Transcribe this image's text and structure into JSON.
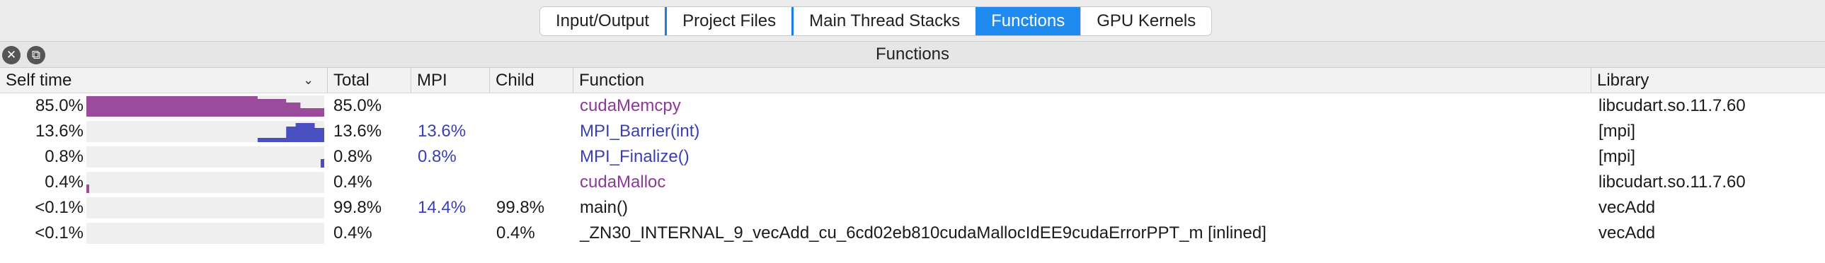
{
  "tabs": [
    {
      "label": "Input/Output",
      "active": false
    },
    {
      "label": "Project Files",
      "active": false
    },
    {
      "label": "Main Thread Stacks",
      "active": false
    },
    {
      "label": "Functions",
      "active": true
    },
    {
      "label": "GPU Kernels",
      "active": false
    }
  ],
  "panel": {
    "title": "Functions",
    "close_icon": "close-icon",
    "float_icon": "float-window-icon"
  },
  "columns": {
    "self_time": "Self time",
    "total": "Total",
    "mpi": "MPI",
    "child": "Child",
    "function": "Function",
    "library": "Library"
  },
  "colors": {
    "gpu": "#9b4b9b",
    "mpi": "#4a4fc0",
    "accent": "#1f8af0"
  },
  "rows": [
    {
      "self": "85.0%",
      "self_value": 85.0,
      "kind": "gpu",
      "total": "85.0%",
      "mpi": "",
      "child": "",
      "function": "cudaMemcpy",
      "library": "libcudart.so.11.7.60"
    },
    {
      "self": "13.6%",
      "self_value": 13.6,
      "kind": "mpi",
      "total": "13.6%",
      "mpi": "13.6%",
      "child": "",
      "function": "MPI_Barrier(int)",
      "library": "[mpi]"
    },
    {
      "self": "0.8%",
      "self_value": 0.8,
      "kind": "mpi",
      "total": "0.8%",
      "mpi": "0.8%",
      "child": "",
      "function": "MPI_Finalize()",
      "library": "[mpi]"
    },
    {
      "self": "0.4%",
      "self_value": 0.4,
      "kind": "gpu",
      "total": "0.4%",
      "mpi": "",
      "child": "",
      "function": "cudaMalloc",
      "library": "libcudart.so.11.7.60"
    },
    {
      "self": "<0.1%",
      "self_value": 0.0,
      "kind": "none",
      "total": "99.8%",
      "mpi": "14.4%",
      "child": "99.8%",
      "function": "main()",
      "library": "vecAdd"
    },
    {
      "self": "<0.1%",
      "self_value": 0.0,
      "kind": "none",
      "total": "0.4%",
      "mpi": "",
      "child": "0.4%",
      "function": "_ZN30_INTERNAL_9_vecAdd_cu_6cd02eb810cudaMallocIdEE9cudaErrorPPT_m [inlined]",
      "library": "vecAdd"
    }
  ]
}
